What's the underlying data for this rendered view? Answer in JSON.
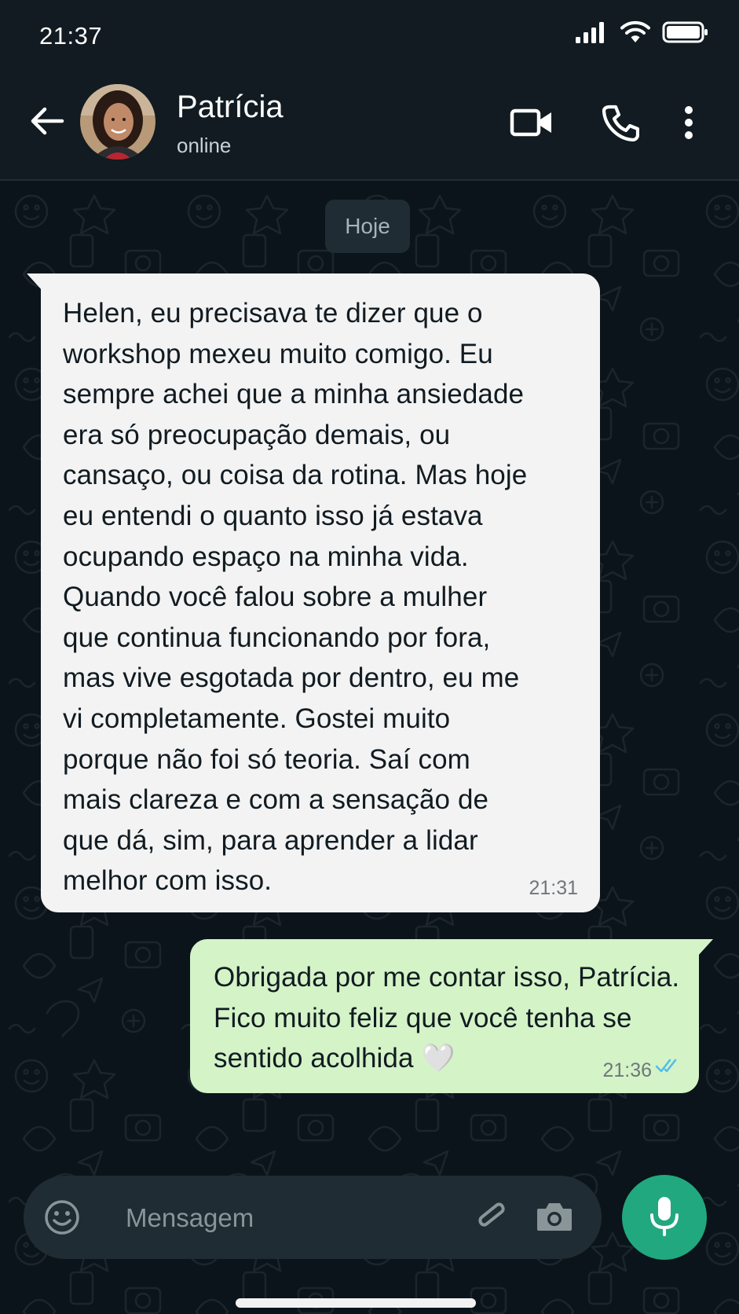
{
  "status_bar": {
    "time": "21:37",
    "icons": [
      "signal-icon",
      "wifi-icon",
      "battery-icon"
    ]
  },
  "header": {
    "contact_name": "Patrícia",
    "contact_status": "online",
    "icons": [
      "back-arrow-icon",
      "video-call-icon",
      "phone-icon",
      "more-options-icon"
    ]
  },
  "chat": {
    "date_chip": "Hoje",
    "messages": [
      {
        "direction": "incoming",
        "text": "Helen, eu precisava te dizer que o\nworkshop mexeu muito comigo. Eu\nsempre achei que a minha ansiedade\nera só preocupação demais, ou\ncansaço, ou coisa da rotina. Mas hoje\neu entendi o quanto isso já estava\nocupando espaço na minha vida.\nQuando você falou sobre a mulher\nque continua funcionando por fora,\nmas vive esgotada por dentro, eu me\nvi completamente. Gostei muito\nporque não foi só teoria. Saí com\nmais clareza e com a sensação de\nque dá, sim, para aprender a lidar\nmelhor com isso.",
        "time": "21:31"
      },
      {
        "direction": "outgoing",
        "text": "Obrigada por me contar isso, Patrícia.\nFico muito feliz que você tenha se\nsentido acolhida 🤍",
        "time": "21:36",
        "status": "read",
        "status_icon": "double-check-icon"
      }
    ]
  },
  "composer": {
    "placeholder": "Mensagem",
    "value": "",
    "icons": [
      "emoji-icon",
      "attach-icon",
      "camera-icon",
      "mic-icon"
    ]
  },
  "colors": {
    "background": "#0b141a",
    "header": "#111b21",
    "incoming_bubble": "#f3f3f3",
    "outgoing_bubble": "#d4f3c7",
    "accent": "#21a87e",
    "read_ticks": "#53bdeb"
  }
}
